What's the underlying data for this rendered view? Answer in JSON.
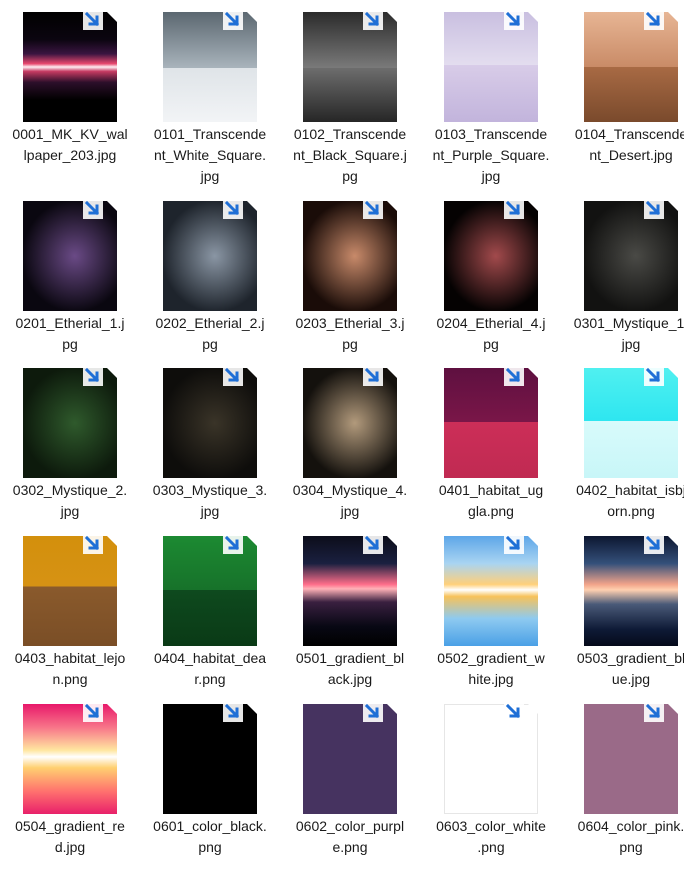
{
  "files": [
    {
      "name": "0001_MK_KV_wallpaper_203.jpg",
      "lines": [
        "0001_MK_KV_wal",
        "lpaper_203.jpg"
      ],
      "thumb": {
        "kind": "bands",
        "stops": [
          [
            "#000000",
            0
          ],
          [
            "#0b0510",
            25
          ],
          [
            "#3a1440",
            38
          ],
          [
            "#e8486e",
            47
          ],
          [
            "#fff0f4",
            50
          ],
          [
            "#c63a62",
            54
          ],
          [
            "#2c0f2a",
            64
          ],
          [
            "#000000",
            80
          ]
        ]
      }
    },
    {
      "name": "0101_Transcendent_White_Square.jpg",
      "lines": [
        "0101_Transcende",
        "nt_White_Square.",
        "jpg"
      ],
      "thumb": {
        "kind": "split",
        "top": [
          "#5b6770",
          "#a9b4bc"
        ],
        "bottom": [
          "#dfe4e8",
          "#f2f4f6"
        ],
        "at": 51
      }
    },
    {
      "name": "0102_Transcendent_Black_Square.jpg",
      "lines": [
        "0102_Transcende",
        "nt_Black_Square.j",
        "pg"
      ],
      "thumb": {
        "kind": "split",
        "top": [
          "#2b2b2b",
          "#7a7a7a"
        ],
        "bottom": [
          "#6d6d6d",
          "#262626"
        ],
        "at": 51
      }
    },
    {
      "name": "0103_Transcendent_Purple_Square.jpg",
      "lines": [
        "0103_Transcende",
        "nt_Purple_Square.",
        "jpg"
      ],
      "thumb": {
        "kind": "split",
        "top": [
          "#c9bfe0",
          "#e3ddef"
        ],
        "bottom": [
          "#d8cce8",
          "#c2b4dc"
        ],
        "at": 48
      }
    },
    {
      "name": "0104_Transcendent_Desert.jpg",
      "lines": [
        "0104_Transcende",
        "nt_Desert.jpg"
      ],
      "thumb": {
        "kind": "split",
        "top": [
          "#e7b594",
          "#c98b67"
        ],
        "bottom": [
          "#a86a44",
          "#7a4a2c"
        ],
        "at": 50
      }
    },
    {
      "name": "0201_Etherial_1.jpg",
      "lines": [
        "0201_Etherial_1.j",
        "pg"
      ],
      "thumb": {
        "kind": "radial",
        "center": "#6a4a86",
        "edge": "#0a0710"
      }
    },
    {
      "name": "0202_Etherial_2.jpg",
      "lines": [
        "0202_Etherial_2.j",
        "pg"
      ],
      "thumb": {
        "kind": "radial",
        "center": "#8a96a4",
        "edge": "#1e242c"
      }
    },
    {
      "name": "0203_Etherial_3.jpg",
      "lines": [
        "0203_Etherial_3.j",
        "pg"
      ],
      "thumb": {
        "kind": "radial",
        "center": "#c88a6a",
        "edge": "#1a0c08"
      }
    },
    {
      "name": "0204_Etherial_4.jpg",
      "lines": [
        "0204_Etherial_4.j",
        "pg"
      ],
      "thumb": {
        "kind": "radial",
        "center": "#a24a4c",
        "edge": "#050202"
      }
    },
    {
      "name": "0301_Mystique_1.jpg",
      "lines": [
        "0301_Mystique_1.",
        "jpg"
      ],
      "thumb": {
        "kind": "radial",
        "center": "#4a4a46",
        "edge": "#121211"
      }
    },
    {
      "name": "0302_Mystique_2.jpg",
      "lines": [
        "0302_Mystique_2.",
        "jpg"
      ],
      "thumb": {
        "kind": "radial",
        "center": "#2f5a2c",
        "edge": "#0d1a0c"
      }
    },
    {
      "name": "0303_Mystique_3.jpg",
      "lines": [
        "0303_Mystique_3.",
        "jpg"
      ],
      "thumb": {
        "kind": "radial",
        "center": "#3a3428",
        "edge": "#0e0d0b"
      }
    },
    {
      "name": "0304_Mystique_4.jpg",
      "lines": [
        "0304_Mystique_4.",
        "jpg"
      ],
      "thumb": {
        "kind": "radial",
        "center": "#b29a7c",
        "edge": "#14110d"
      }
    },
    {
      "name": "0401_habitat_ugla.png",
      "lines": [
        "0401_habitat_ug",
        "gla.png"
      ],
      "thumb": {
        "kind": "split",
        "top": [
          "#5e1040",
          "#7a1648"
        ],
        "bottom": [
          "#cc2e58",
          "#c02a52"
        ],
        "at": 49
      }
    },
    {
      "name": "0402_habitat_isbjorn.png",
      "lines": [
        "0402_habitat_isbj",
        "orn.png"
      ],
      "thumb": {
        "kind": "split",
        "top": [
          "#50f0f0",
          "#2ee6f0"
        ],
        "bottom": [
          "#d8fbfb",
          "#c8f6f8"
        ],
        "at": 48
      }
    },
    {
      "name": "0403_habitat_lejon.png",
      "lines": [
        "0403_habitat_lejo",
        "n.png"
      ],
      "thumb": {
        "kind": "split",
        "top": [
          "#d3900c",
          "#d69214"
        ],
        "bottom": [
          "#8a5a2c",
          "#7a4e26"
        ],
        "at": 46
      }
    },
    {
      "name": "0404_habitat_dear.png",
      "lines": [
        "0404_habitat_dea",
        "r.png"
      ],
      "thumb": {
        "kind": "split",
        "top": [
          "#1c8a32",
          "#17722a"
        ],
        "bottom": [
          "#0e4a1e",
          "#0a3a16"
        ],
        "at": 49
      }
    },
    {
      "name": "0501_gradient_black.jpg",
      "lines": [
        "0501_gradient_bl",
        "ack.jpg"
      ],
      "thumb": {
        "kind": "bands",
        "stops": [
          [
            "#0c0d1a",
            0
          ],
          [
            "#1a2040",
            25
          ],
          [
            "#ff6e8a",
            44
          ],
          [
            "#ffb2b8",
            48
          ],
          [
            "#3a2040",
            60
          ],
          [
            "#080814",
            82
          ],
          [
            "#000000",
            100
          ]
        ]
      }
    },
    {
      "name": "0502_gradient_white.jpg",
      "lines": [
        "0502_gradient_w",
        "hite.jpg"
      ],
      "thumb": {
        "kind": "bands",
        "stops": [
          [
            "#5da6e8",
            0
          ],
          [
            "#a9d4f2",
            25
          ],
          [
            "#ffd07a",
            44
          ],
          [
            "#ffffff",
            49
          ],
          [
            "#f7c25a",
            55
          ],
          [
            "#8ecaf0",
            75
          ],
          [
            "#4aa0e6",
            100
          ]
        ]
      }
    },
    {
      "name": "0503_gradient_blue.jpg",
      "lines": [
        "0503_gradient_bl",
        "ue.jpg"
      ],
      "thumb": {
        "kind": "bands",
        "stops": [
          [
            "#0c1630",
            0
          ],
          [
            "#34507a",
            25
          ],
          [
            "#f2a48a",
            44
          ],
          [
            "#ffd0b0",
            49
          ],
          [
            "#4a5a78",
            62
          ],
          [
            "#0e1a36",
            85
          ],
          [
            "#050a1a",
            100
          ]
        ]
      }
    },
    {
      "name": "0504_gradient_red.jpg",
      "lines": [
        "0504_gradient_re",
        "d.jpg"
      ],
      "thumb": {
        "kind": "bands",
        "stops": [
          [
            "#e8186a",
            0
          ],
          [
            "#f8788a",
            22
          ],
          [
            "#ffe6a0",
            42
          ],
          [
            "#ffffff",
            48
          ],
          [
            "#ffd070",
            58
          ],
          [
            "#ff6f6e",
            80
          ],
          [
            "#e8206a",
            100
          ]
        ]
      }
    },
    {
      "name": "0601_color_black.png",
      "lines": [
        "0601_color_black.",
        "png"
      ],
      "thumb": {
        "kind": "solid",
        "color": "#000000"
      }
    },
    {
      "name": "0602_color_purple.png",
      "lines": [
        "0602_color_purpl",
        "e.png"
      ],
      "thumb": {
        "kind": "solid",
        "color": "#463360"
      }
    },
    {
      "name": "0603_color_white.png",
      "lines": [
        "0603_color_white",
        ".png"
      ],
      "thumb": {
        "kind": "solid",
        "color": "#ffffff",
        "border": "#e6e6e6"
      }
    },
    {
      "name": "0604_color_pink.png",
      "lines": [
        "0604_color_pink.",
        "png"
      ],
      "thumb": {
        "kind": "solid",
        "color": "#9a6a88"
      }
    }
  ],
  "overlay_icon": "shortcut-arrow-icon",
  "colors": {
    "badge_arrow": "#1f6fd6",
    "badge_bg": "#ffffff",
    "label_text": "#1a1a1a"
  }
}
